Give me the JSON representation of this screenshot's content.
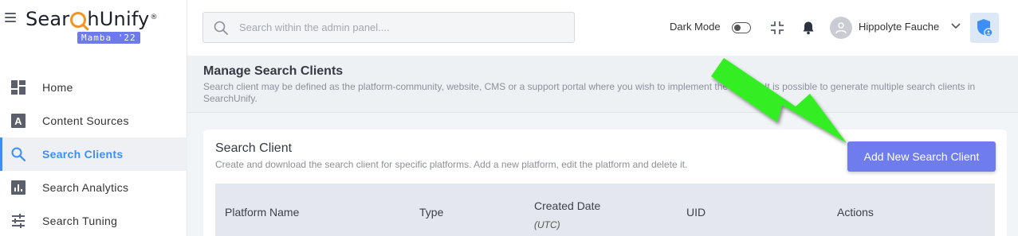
{
  "app": {
    "logo_text_before": "Sear",
    "logo_text_after": "hUnify",
    "logo_tm": "®",
    "version_badge": "Mamba '22"
  },
  "sidebar": {
    "items": [
      {
        "label": "Home",
        "icon": "dashboard-icon",
        "active": false
      },
      {
        "label": "Content Sources",
        "icon": "content-sources-icon",
        "active": false
      },
      {
        "label": "Search Clients",
        "icon": "search-icon",
        "active": true
      },
      {
        "label": "Search Analytics",
        "icon": "analytics-icon",
        "active": false
      },
      {
        "label": "Search Tuning",
        "icon": "tuning-icon",
        "active": false
      }
    ]
  },
  "header": {
    "search_placeholder": "Search within the admin panel....",
    "dark_mode_label": "Dark Mode",
    "dark_mode_on": false,
    "username": "Hippolyte Fauche"
  },
  "page": {
    "title": "Manage Search Clients",
    "description": "Search client may be defined as the platform-community, website, CMS or a support portal where you wish to implement the search. It is possible to generate multiple search clients in SearchUnify."
  },
  "card": {
    "title": "Search Client",
    "description": "Create and download the search client for specific platforms. Add a new platform, edit the platform and delete it.",
    "add_button_label": "Add New Search Client",
    "table_headers": {
      "platform_name": "Platform Name",
      "type": "Type",
      "created_date": "Created Date",
      "created_date_sub": "(UTC)",
      "uid": "UID",
      "actions": "Actions"
    }
  },
  "colors": {
    "accent": "#3d8ff5",
    "button": "#6f7cee",
    "logo_orange": "#f39321",
    "annotation_arrow": "#33ee22"
  }
}
